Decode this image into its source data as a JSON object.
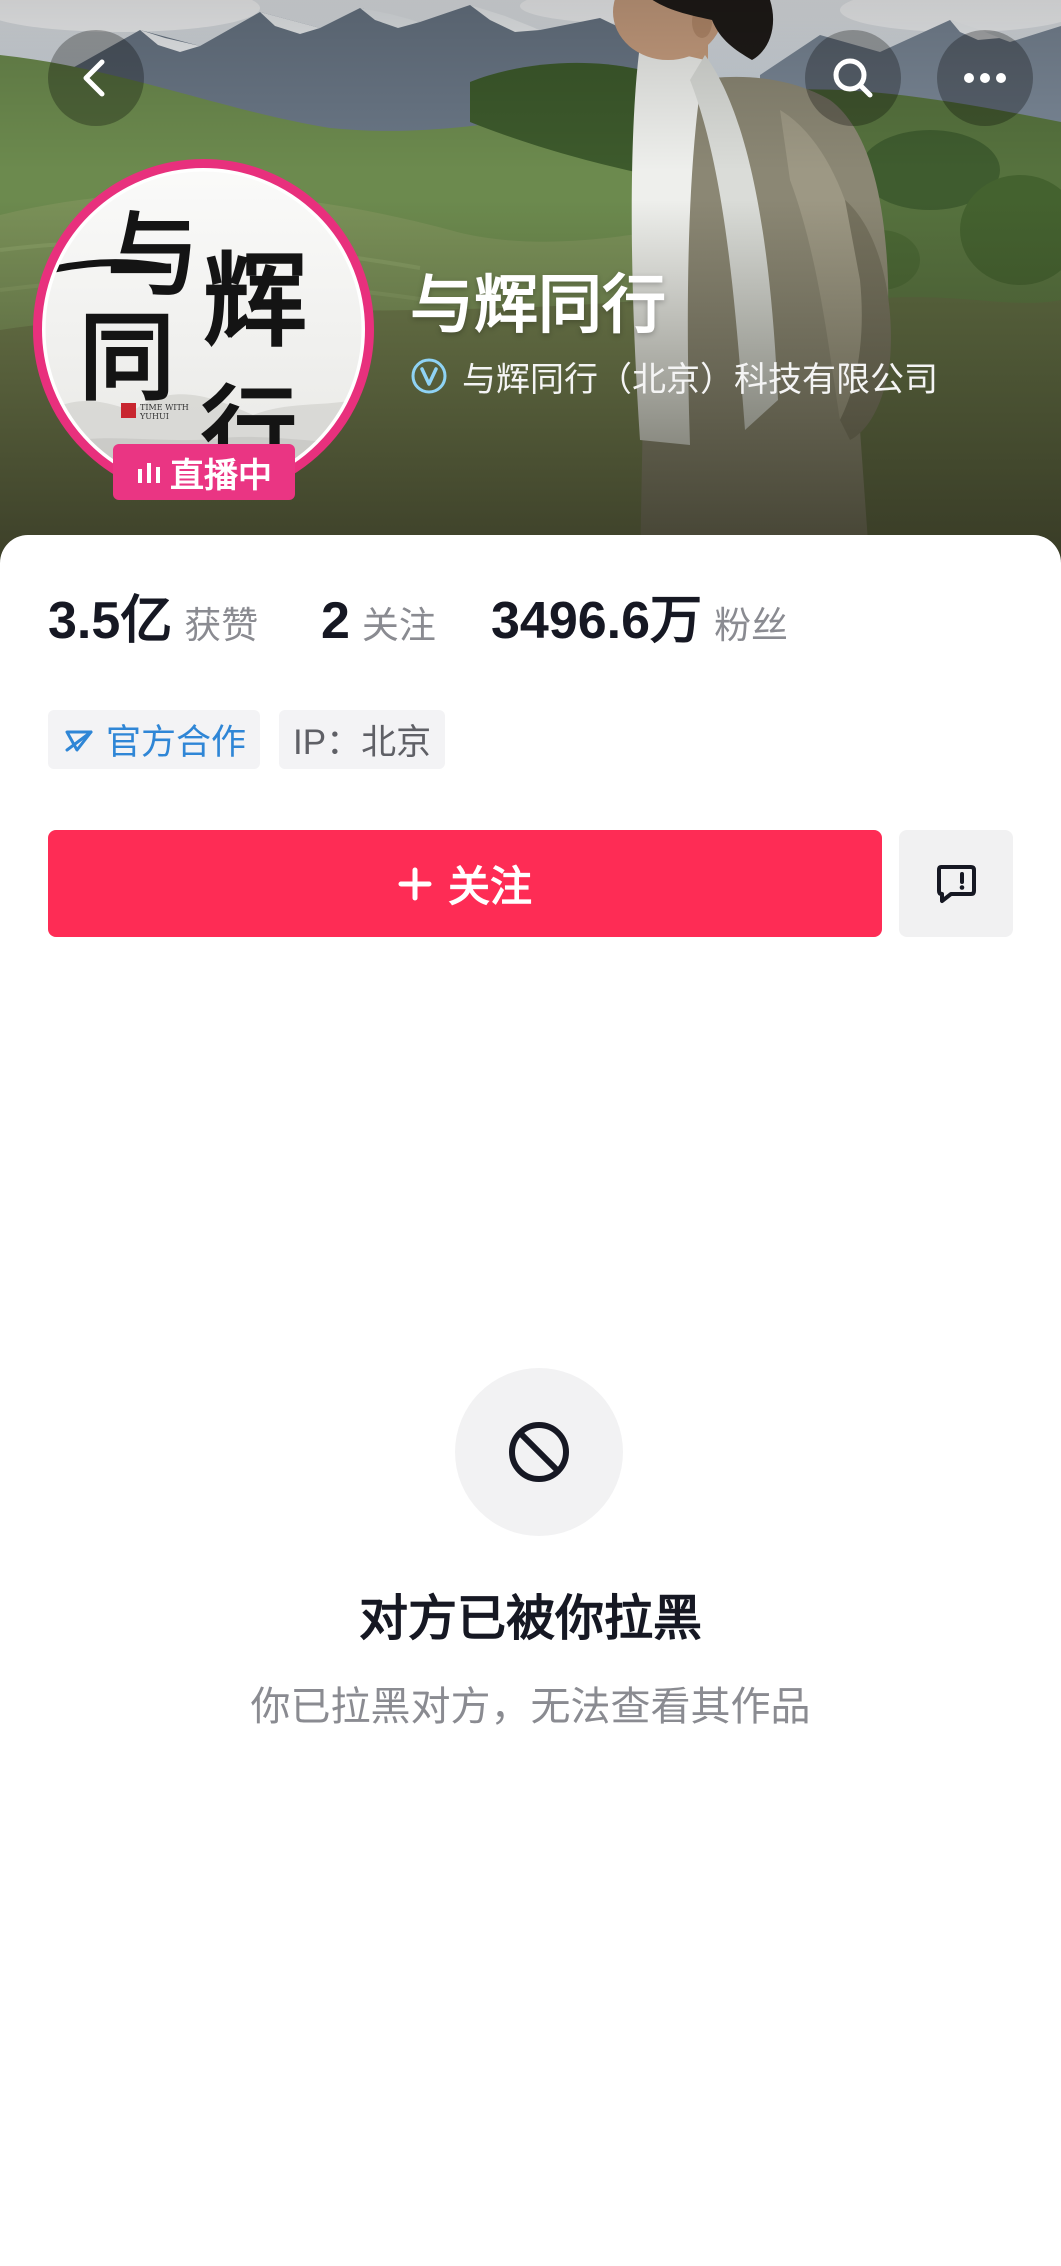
{
  "header": {
    "back_icon": "chevron-left-icon",
    "search_icon": "search-icon",
    "more_icon": "more-horizontal-icon"
  },
  "profile": {
    "avatar_logo": {
      "chars": [
        "与",
        "辉",
        "同",
        "行"
      ],
      "tagline": [
        "TIME WITH",
        "YUHUI"
      ]
    },
    "live_badge": {
      "icon": "live-bars-icon",
      "label": "直播中"
    },
    "name": "与辉同行",
    "verification": {
      "icon": "verified-badge-icon",
      "text": "与辉同行（北京）科技有限公司"
    }
  },
  "stats": [
    {
      "value": "3.5亿",
      "label": "获赞"
    },
    {
      "value": "2",
      "label": "关注"
    },
    {
      "value": "3496.6万",
      "label": "粉丝"
    }
  ],
  "tags": [
    {
      "icon": "official-cooperation-icon",
      "label": "官方合作"
    },
    {
      "label": "IP：北京"
    }
  ],
  "actions": {
    "follow": {
      "icon": "plus-icon",
      "label": "关注"
    },
    "message": {
      "icon": "message-icon"
    }
  },
  "blocked_notice": {
    "icon": "block-icon",
    "title": "对方已被你拉黑",
    "subtitle": "你已拉黑对方，无法查看其作品"
  },
  "colors": {
    "follow_button": "#fe2c55",
    "live_badge": "#ea3583",
    "avatar_ring": "#e8307d",
    "official_tag_text": "#2f86d6",
    "primary_text": "#161823",
    "secondary_text": "#8a8b91"
  }
}
